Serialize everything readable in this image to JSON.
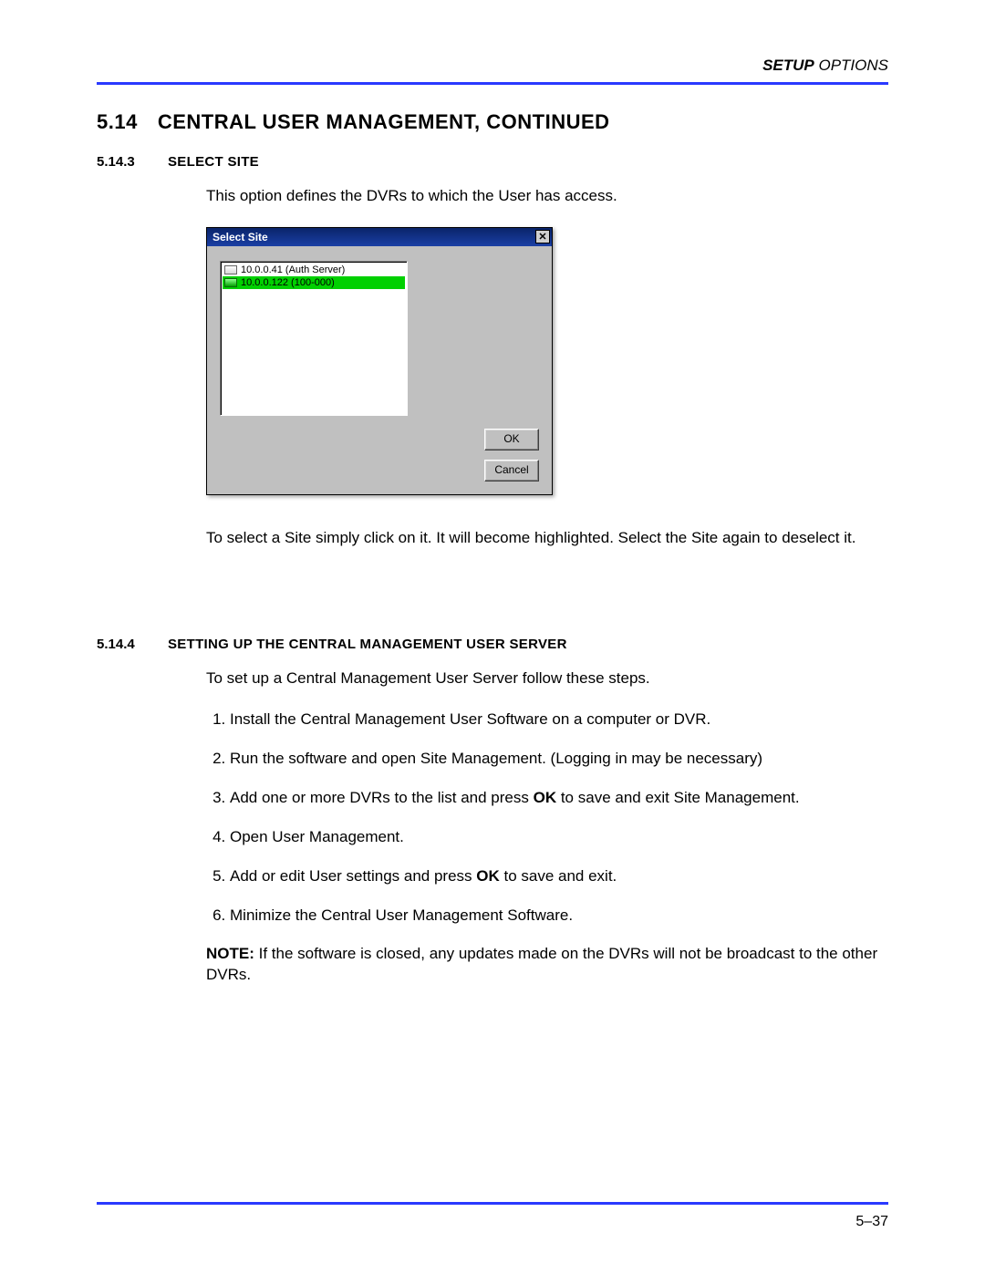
{
  "header": {
    "bold": "SETUP",
    "light": " OPTIONS"
  },
  "section": {
    "number": "5.14",
    "title": "CENTRAL USER MANAGEMENT, CONTINUED"
  },
  "sub1": {
    "number": "5.14.3",
    "title": "SELECT SITE",
    "intro": "This option defines the DVRs to which the User has access.",
    "after": "To select a Site simply click on it. It will become highlighted. Select the Site again to deselect it."
  },
  "dialog": {
    "title": "Select Site",
    "items": [
      {
        "label": "10.0.0.41 (Auth Server)",
        "selected": false
      },
      {
        "label": "10.0.0.122 (100-000)",
        "selected": true
      }
    ],
    "ok": "OK",
    "cancel": "Cancel"
  },
  "sub2": {
    "number": "5.14.4",
    "title": "SETTING UP THE CENTRAL MANAGEMENT USER SERVER",
    "intro": "To set up a Central Management User Server follow these steps.",
    "steps": [
      {
        "text": "Install the Central Management User Software on a computer or DVR."
      },
      {
        "text": "Run the software and open Site Management. (Logging in may be necessary)"
      },
      {
        "pre": "Add one or more DVRs to the list and press ",
        "bold": "OK",
        "post": " to save and exit Site Management."
      },
      {
        "text": "Open User Management."
      },
      {
        "pre": "Add or edit User settings and press ",
        "bold": "OK",
        "post": " to save and exit."
      },
      {
        "text": "Minimize the Central User Management Software."
      }
    ],
    "note_label": "NOTE:",
    "note_body": " If the software is closed, any updates made on the DVRs will not be broadcast to the other DVRs."
  },
  "footer": {
    "page": "5–37"
  }
}
